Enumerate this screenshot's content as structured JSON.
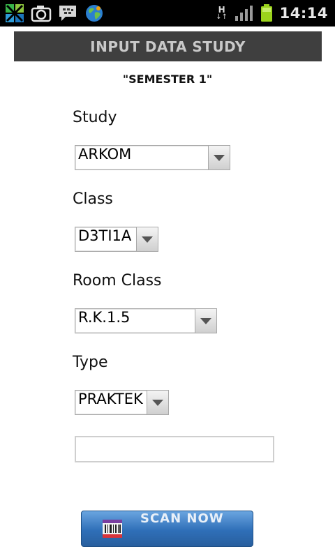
{
  "status_bar": {
    "time": "14:14",
    "network_label": "H",
    "icons": [
      "dxhome-icon",
      "camera-icon",
      "bbm-icon",
      "globe-icon",
      "network-arrows-icon",
      "signal-icon",
      "battery-icon"
    ]
  },
  "header": {
    "title": "INPUT DATA STUDY"
  },
  "subtitle": "\"SEMESTER 1\"",
  "form": {
    "study": {
      "label": "Study",
      "value": "ARKOM"
    },
    "class": {
      "label": "Class",
      "value": "D3TI1A"
    },
    "room_class": {
      "label": "Room Class",
      "value": "R.K.1.5"
    },
    "type": {
      "label": "Type",
      "value": "PRAKTEK"
    },
    "input_value": ""
  },
  "scan_button": {
    "label": "SCAN NOW",
    "icon": "barcode-icon"
  },
  "colors": {
    "header_bg": "#3f3f3f",
    "header_text": "#c9c9c9",
    "button_blue": "#2f6fb8",
    "battery_green": "#9bd31c"
  }
}
